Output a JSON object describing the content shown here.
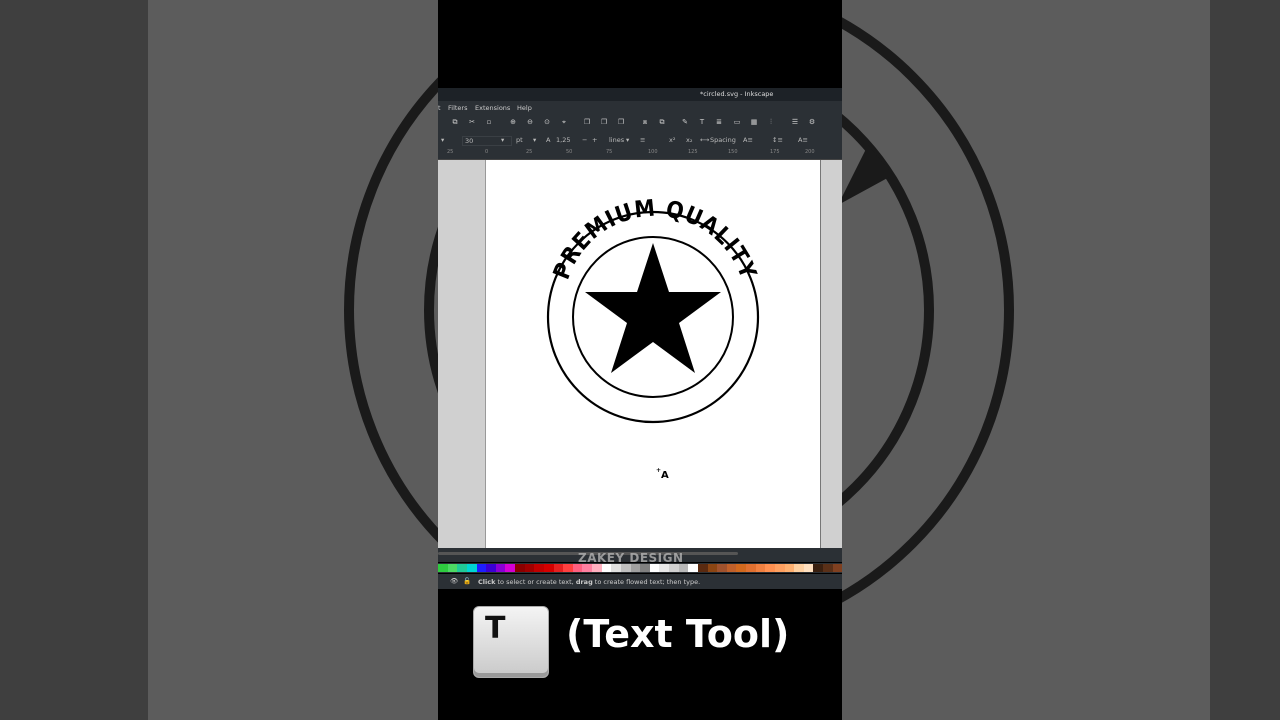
{
  "window": {
    "title": "*circled.svg - Inkscape"
  },
  "menu": {
    "items": [
      "t",
      "Filters",
      "Extensions",
      "Help"
    ]
  },
  "text_toolbar": {
    "font_size": "30",
    "unit": "pt",
    "line_spacing": "1,25",
    "spacing_mode": "lines",
    "spacing_label": "Spacing"
  },
  "ruler": {
    "ticks": [
      "25",
      "0",
      "25",
      "50",
      "75",
      "100",
      "125",
      "150",
      "175",
      "200"
    ]
  },
  "canvas": {
    "logo_text": "PREMIUM QUALITY",
    "cursor_glyph": "A"
  },
  "watermark": "ZAKEY DESIGN",
  "status": {
    "message_bold_1": "Click",
    "message_1": " to select or create text, ",
    "message_bold_2": "drag",
    "message_2": " to create flowed text; then type."
  },
  "overlay": {
    "key_label": "T",
    "caption": "(Text Tool)"
  },
  "palette": {
    "colors": [
      "#2ecc40",
      "#4cd964",
      "#20c997",
      "#00d4d4",
      "#1e1eff",
      "#3b00d4",
      "#8a00d4",
      "#d400d4",
      "#8b0000",
      "#a00000",
      "#c00000",
      "#d40000",
      "#e62020",
      "#ff4040",
      "#ff6080",
      "#ff80a0",
      "#ffb0c0",
      "#ffffff",
      "#e0e0e0",
      "#c0c0c0",
      "#a0a0a0",
      "#808080",
      "#ffffff",
      "#e8e8e8",
      "#d0d0d0",
      "#b8b8b8",
      "#ffffff",
      "#5a2a10",
      "#8b4513",
      "#a0522d",
      "#c0602a",
      "#d2691e",
      "#e07030",
      "#f08040",
      "#ff9050",
      "#ffa060",
      "#ffb070",
      "#ffd0a0",
      "#ffe0c0",
      "#3a2010",
      "#5a3018",
      "#804020"
    ]
  }
}
